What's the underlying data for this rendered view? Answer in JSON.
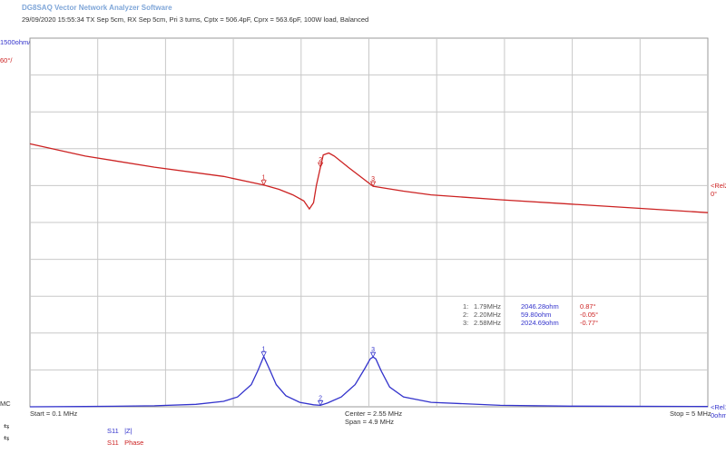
{
  "header": {
    "title": "DG8SAQ Vector Network Analyzer Software",
    "subtitle": "29/09/2020   15:55:34   TX Sep 5cm, RX Sep 5cm, Pri 3 turns, Cptx = 506.4pF, Cprx = 563.6pF, 100W load, Balanced"
  },
  "axis": {
    "left_top_blue": "1500ohm/",
    "left_top_red": "60°/",
    "left_mc": "MC",
    "right_rel2": "<Rel2",
    "right_rel2_val": "0°",
    "right_rel1": "<Rel1",
    "right_rel1_val": "0ohm",
    "start": "Start = 0.1 MHz",
    "center": "Center = 2.55 MHz",
    "span": "Span = 4.9 MHz",
    "stop": "Stop = 5 MHz"
  },
  "markers": [
    {
      "idx": "1:",
      "freq": "1.79MHz",
      "mag": "2046.28ohm",
      "phase": "0.87°"
    },
    {
      "idx": "2:",
      "freq": "2.20MHz",
      "mag": "59.80ohm",
      "phase": "-0.05°"
    },
    {
      "idx": "3:",
      "freq": "2.58MHz",
      "mag": "2024.69ohm",
      "phase": "-0.77°"
    }
  ],
  "legend": [
    {
      "name": "S11",
      "label": "|Z|",
      "color": "#3333cc"
    },
    {
      "name": "S11",
      "label": "Phase",
      "color": "#cc2222"
    }
  ],
  "colors": {
    "magnitude": "#3333cc",
    "phase": "#cc2222",
    "grid": "#c8c8c8"
  },
  "chart_data": {
    "type": "line",
    "x_unit": "MHz",
    "xlim": [
      0.1,
      5.0
    ],
    "grid": true,
    "series": [
      {
        "name": "S11 |Z|",
        "unit": "ohm",
        "scale_per_div": 1500,
        "ref": 0,
        "x": [
          0.1,
          0.5,
          1.0,
          1.3,
          1.5,
          1.6,
          1.7,
          1.75,
          1.79,
          1.83,
          1.88,
          1.95,
          2.05,
          2.15,
          2.2,
          2.25,
          2.35,
          2.45,
          2.52,
          2.56,
          2.58,
          2.6,
          2.64,
          2.7,
          2.8,
          3.0,
          3.5,
          4.0,
          5.0
        ],
        "y": [
          0,
          10,
          40,
          100,
          220,
          400,
          900,
          1500,
          2046,
          1550,
          900,
          450,
          180,
          80,
          60,
          150,
          400,
          900,
          1550,
          1950,
          2025,
          1950,
          1450,
          800,
          400,
          180,
          60,
          25,
          10
        ]
      },
      {
        "name": "S11 Phase",
        "unit": "deg",
        "scale_per_div": 60,
        "ref": 0,
        "x": [
          0.1,
          0.5,
          1.0,
          1.5,
          1.79,
          1.9,
          2.0,
          2.08,
          2.12,
          2.15,
          2.17,
          2.2,
          2.22,
          2.26,
          2.3,
          2.4,
          2.58,
          2.8,
          3.0,
          3.5,
          4.0,
          4.5,
          5.0
        ],
        "y": [
          68,
          48,
          30,
          15,
          1,
          -6,
          -15,
          -25,
          -38,
          -28,
          0,
          30,
          50,
          53,
          48,
          30,
          -1,
          -9,
          -15,
          -23,
          -30,
          -37,
          -44
        ]
      }
    ],
    "marker_x": [
      1.79,
      2.2,
      2.58
    ]
  }
}
